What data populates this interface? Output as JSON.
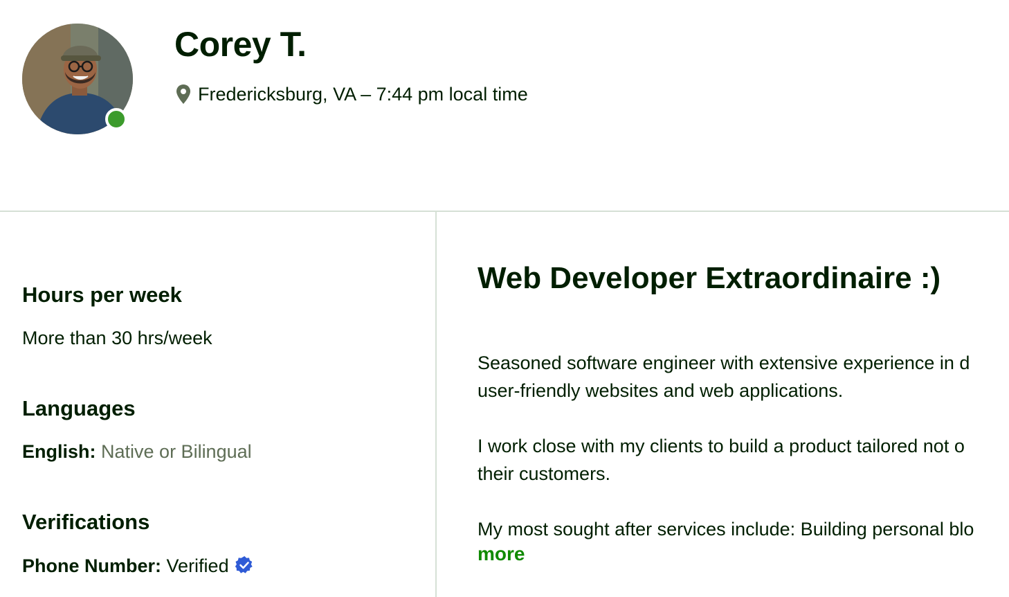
{
  "profile": {
    "name": "Corey T.",
    "location": "Fredericksburg, VA – 7:44 pm local time",
    "online_status_color": "#3c9b2c"
  },
  "sidebar": {
    "hours": {
      "title": "Hours per week",
      "value": "More than 30 hrs/week"
    },
    "languages": {
      "title": "Languages",
      "items": [
        {
          "name": "English:",
          "level": "Native or Bilingual"
        }
      ]
    },
    "verifications": {
      "title": "Verifications",
      "items": [
        {
          "label": "Phone Number:",
          "status": "Verified"
        }
      ]
    }
  },
  "overview": {
    "title": "Web Developer Extraordinaire :)",
    "paragraphs": [
      {
        "line1": "Seasoned software engineer with extensive experience in d",
        "line2": "user-friendly websites and web applications."
      },
      {
        "line1": "I work close with my clients to build a product tailored not o",
        "line2": "their customers."
      },
      {
        "line1": "My most sought after services include: Building personal blo"
      }
    ],
    "more_label": "more"
  },
  "colors": {
    "text": "#001e00",
    "accent_green": "#108a00",
    "muted": "#5e6d55",
    "verified_blue": "#2f5bd6",
    "divider": "#d5e0d5"
  },
  "icons": {
    "location": "map-pin-icon",
    "verified": "verified-badge-icon"
  }
}
